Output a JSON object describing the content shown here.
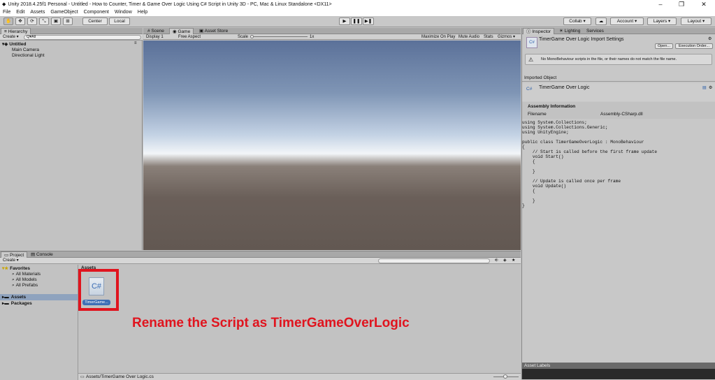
{
  "window": {
    "title": "Unity 2018.4.25f1 Personal - Untitled - How to Counter, Timer & Game Over Logic Using C# Script in Unity 3D - PC, Mac & Linux Standalone <DX11>"
  },
  "menu": [
    "File",
    "Edit",
    "Assets",
    "GameObject",
    "Component",
    "Window",
    "Help"
  ],
  "toolbar": {
    "center": "Center",
    "local": "Local",
    "collab": "Collab ▾",
    "account": "Account ▾",
    "layers": "Layers ▾",
    "layout": "Layout ▾"
  },
  "hierarchy": {
    "tab": "Hierarchy",
    "create": "Create ▾",
    "search": "Q▾All",
    "scene": "Untitled",
    "items": [
      "Main Camera",
      "Directional Light"
    ]
  },
  "center_tabs": {
    "scene": "Scene",
    "game": "Game",
    "asset_store": "Asset Store"
  },
  "game_bar": {
    "display": "Display 1",
    "aspect": "Free Aspect",
    "scale_label": "Scale",
    "scale_value": "1x",
    "maximize": "Maximize On Play",
    "mute": "Mute Audio",
    "stats": "Stats",
    "gizmos": "Gizmos ▾"
  },
  "inspector": {
    "tabs": [
      "Inspector",
      "Lighting",
      "Services"
    ],
    "title": "TimerGame Over Logic Import Settings",
    "open": "Open...",
    "exec_order": "Execution Order...",
    "warning": "No MonoBehaviour scripts in the file, or their names do not match the file name.",
    "imported_object": "Imported Object",
    "object_name": "TimerGame Over Logic",
    "assembly_heading": "Assembly Information",
    "filename_label": "Filename",
    "filename_value": "Assembly-CSharp.dll",
    "code": "using System.Collections;\nusing System.Collections.Generic;\nusing UnityEngine;\n\npublic class TimerGameOverLogic : MonoBehaviour\n{\n    // Start is called before the first frame update\n    void Start()\n    {\n\n    }\n\n    // Update is called once per frame\n    void Update()\n    {\n\n    }\n}",
    "asset_labels": "Asset Labels"
  },
  "project": {
    "tabs": [
      "Project",
      "Console"
    ],
    "create": "Create ▾",
    "favorites": "Favorites",
    "fav_items": [
      "All Materials",
      "All Models",
      "All Prefabs"
    ],
    "assets": "Assets",
    "packages": "Packages",
    "assets_header": "Assets",
    "file_label": "TimerGame...",
    "path": "Assets/TimerGame Over Logic.cs"
  },
  "annotation": "Rename the Script as TimerGameOverLogic",
  "colors": {
    "annotation": "#e0141e",
    "highlight_box": "#e0141e",
    "selection": "#3d6fb6"
  }
}
